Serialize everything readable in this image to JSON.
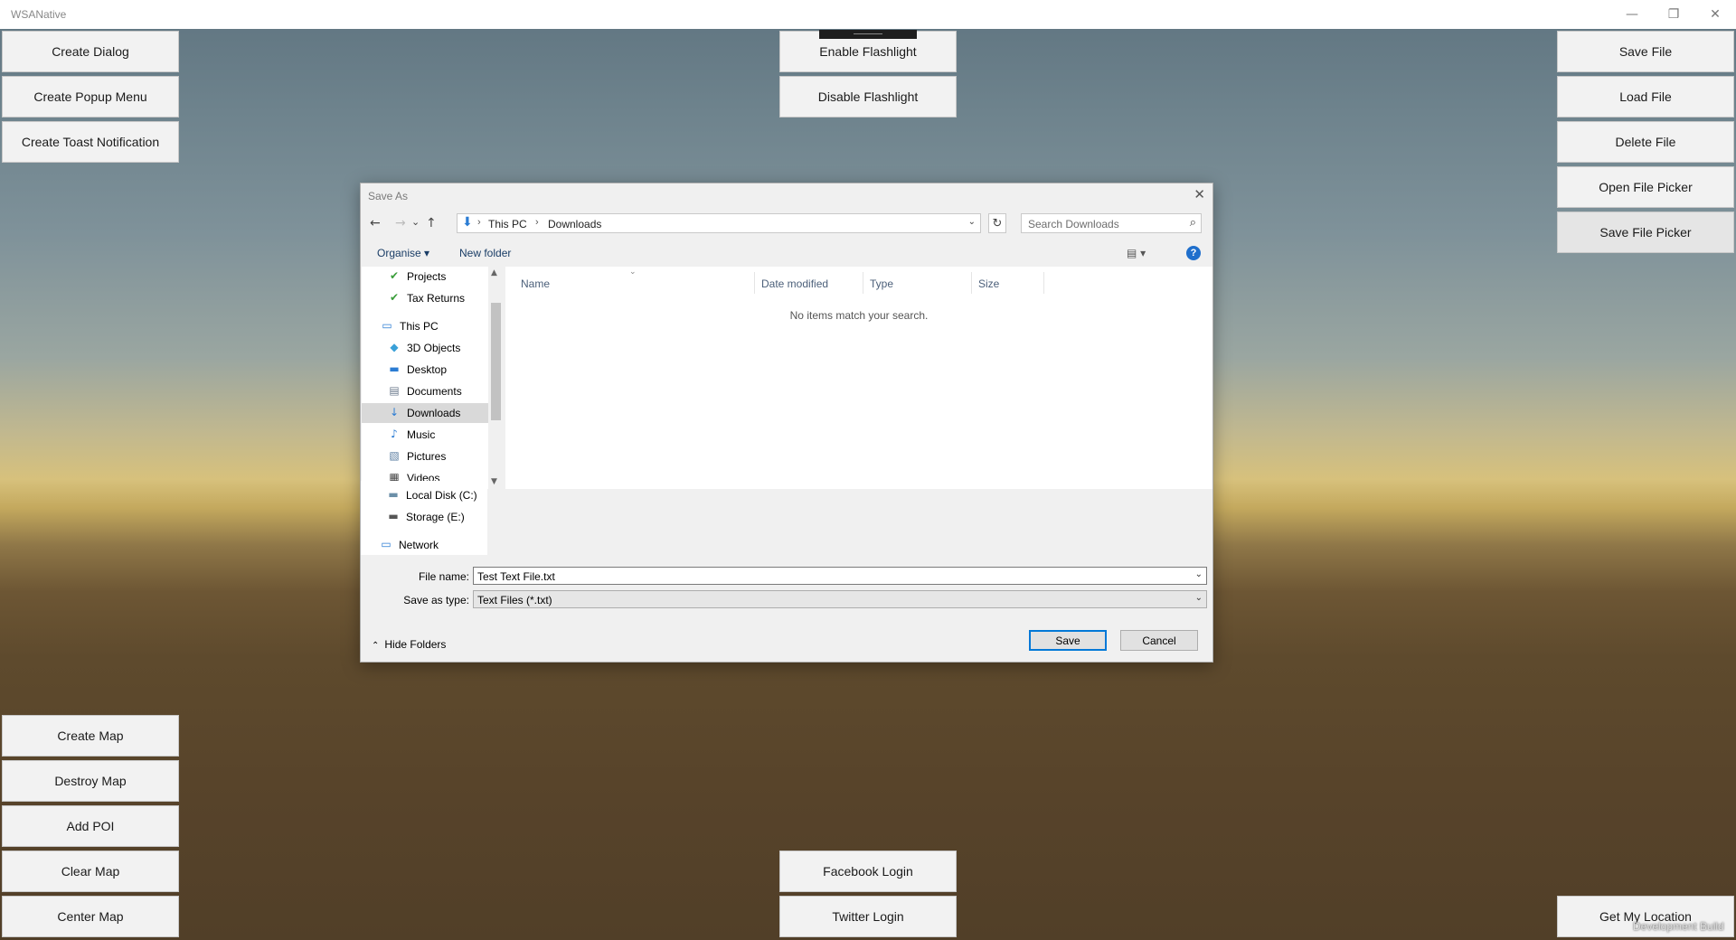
{
  "window": {
    "title": "WSANative",
    "minimize": "—",
    "restore": "❐",
    "close": "✕"
  },
  "left_buttons": [
    "Create Dialog",
    "Create Popup Menu",
    "Create Toast Notification"
  ],
  "center_top_buttons": [
    "Enable Flashlight",
    "Disable Flashlight"
  ],
  "right_buttons": [
    "Save File",
    "Load File",
    "Delete File",
    "Open File Picker",
    "Save File Picker"
  ],
  "map_buttons": [
    "Create Map",
    "Destroy Map",
    "Add POI",
    "Clear Map",
    "Center Map"
  ],
  "login_buttons": [
    "Facebook Login",
    "Twitter Login"
  ],
  "location_button": "Get My Location",
  "watermark": "Development Build",
  "dialog": {
    "title": "Save As",
    "close": "✕",
    "nav": {
      "back": "←",
      "forward": "→",
      "recent": "⌄",
      "up": "↑"
    },
    "address": {
      "icon": "download-icon",
      "crumbs": [
        "This PC",
        "Downloads"
      ],
      "sep": "›",
      "dropdown": "⌄"
    },
    "refresh": "↻",
    "search_placeholder": "Search Downloads",
    "toolbar": {
      "organise": "Organise ▾",
      "new_folder": "New folder",
      "view": "▤ ▾",
      "help": "?"
    },
    "nav_items": [
      {
        "label": "Projects",
        "icon": "folder-sync-icon",
        "glyph": "✔",
        "color": "#3a9d3a"
      },
      {
        "label": "Tax Returns",
        "icon": "folder-sync-icon",
        "glyph": "✔",
        "color": "#3a9d3a"
      },
      {
        "label": "This PC",
        "icon": "computer-icon",
        "glyph": "▭",
        "color": "#2b7cd3"
      },
      {
        "label": "3D Objects",
        "icon": "cube-icon",
        "glyph": "◆",
        "color": "#3aa0d8"
      },
      {
        "label": "Desktop",
        "icon": "desktop-icon",
        "glyph": "▬",
        "color": "#2b7cd3"
      },
      {
        "label": "Documents",
        "icon": "document-icon",
        "glyph": "▤",
        "color": "#6b7a8c"
      },
      {
        "label": "Downloads",
        "icon": "download-icon",
        "glyph": "↓",
        "color": "#2b7cd3"
      },
      {
        "label": "Music",
        "icon": "music-icon",
        "glyph": "♪",
        "color": "#2b7cd3"
      },
      {
        "label": "Pictures",
        "icon": "pictures-icon",
        "glyph": "▧",
        "color": "#5a7da0"
      },
      {
        "label": "Videos",
        "icon": "video-icon",
        "glyph": "▦",
        "color": "#444"
      },
      {
        "label": "Local Disk (C:)",
        "icon": "disk-icon",
        "glyph": "▬",
        "color": "#6b8fa8"
      },
      {
        "label": "Storage (E:)",
        "icon": "drive-icon",
        "glyph": "▬",
        "color": "#555"
      },
      {
        "label": "Network",
        "icon": "network-icon",
        "glyph": "▭",
        "color": "#2b7cd3"
      }
    ],
    "columns": [
      "Name",
      "Date modified",
      "Type",
      "Size"
    ],
    "empty_message": "No items match your search.",
    "file_name_label": "File name:",
    "file_name_value": "Test Text File.txt",
    "save_type_label": "Save as type:",
    "save_type_value": "Text Files (*.txt)",
    "hide_folders": "Hide Folders",
    "save_button": "Save",
    "cancel_button": "Cancel"
  }
}
